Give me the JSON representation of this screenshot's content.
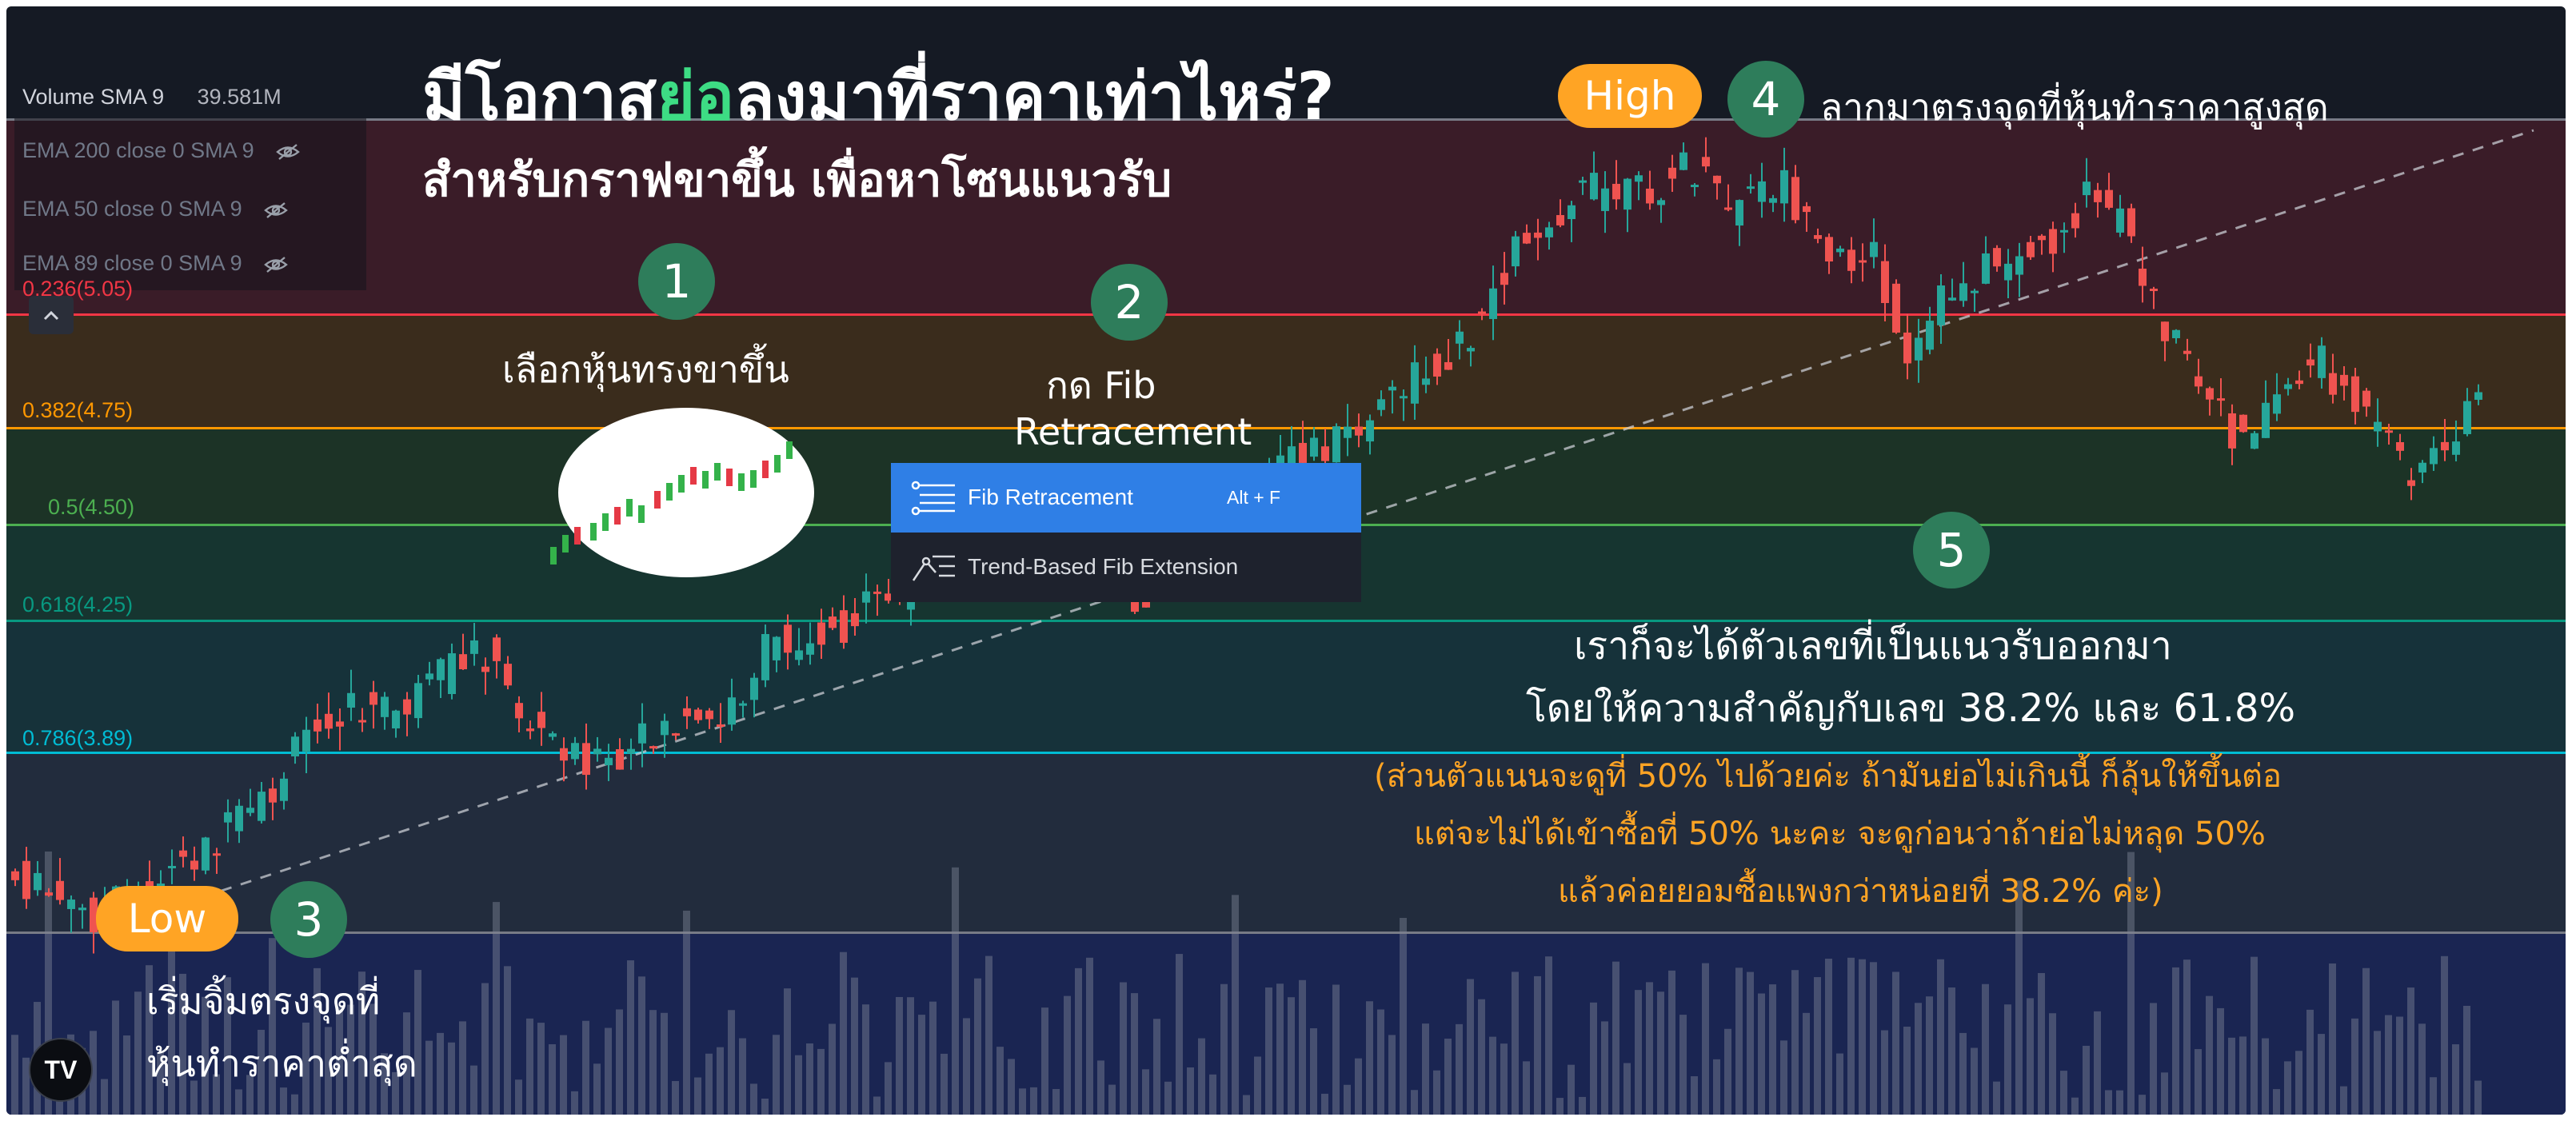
{
  "title": {
    "line1_part1": "มีโอกาส",
    "line1_highlight": "ย่อ",
    "line1_part2": "ลงมาที่ราคาเท่าไหร่?",
    "line2": "สำหรับกราฟขาขึ้น เพื่อหาโซนแนวรับ"
  },
  "colors": {
    "accent_orange": "#ffa424",
    "step_green": "#2e7d5b",
    "highlight_green": "#3ddc84",
    "menu_blue": "#2f7fe6"
  },
  "indicators": [
    {
      "label": "Volume SMA 9",
      "value": "39.581M"
    },
    {
      "label": "EMA 200 close 0 SMA 9",
      "icon": "eye-off-icon"
    },
    {
      "label": "EMA 50 close 0 SMA 9",
      "icon": "eye-off-icon"
    },
    {
      "label": "EMA 89 close 0 SMA 9",
      "icon": "eye-off-icon"
    }
  ],
  "fib_levels": [
    {
      "label": "0.236(5.05)",
      "color": "#f23645"
    },
    {
      "label": "0.382(4.75)",
      "color": "#ff9800"
    },
    {
      "label": "0.5(4.50)",
      "color": "#4caf50"
    },
    {
      "label": "0.618(4.25)",
      "color": "#089981"
    },
    {
      "label": "0.786(3.89)",
      "color": "#00bcd4"
    }
  ],
  "steps": [
    {
      "number": "1",
      "text": "เลือกหุ้นทรงขาขึ้น"
    },
    {
      "number": "2",
      "text_line1": "กด Fib",
      "text_line2": "Retracement"
    },
    {
      "number": "3",
      "badge": "Low",
      "text_line1": "เริ่มจิ้มตรงจุดที่",
      "text_line2": "หุ้นทำราคาต่ำสุด"
    },
    {
      "number": "4",
      "badge": "High",
      "text": "ลากมาตรงจุดที่หุ้นทำราคาสูงสุด"
    },
    {
      "number": "5",
      "text_line1": "เราก็จะได้ตัวเลขที่เป็นแนวรับออกมา",
      "text_line2": "โดยให้ความสำคัญกับเลข 38.2% และ 61.8%"
    }
  ],
  "note": {
    "line1": "(ส่วนตัวแนนจะดูที่ 50% ไปด้วยค่ะ ถ้ามันย่อไม่เกินนี้ ก็ลุ้นให้ขึ้นต่อ",
    "line2": "แต่จะไม่ได้เข้าซื้อที่ 50% นะคะ จะดูก่อนว่าถ้าย่อไม่หลุด 50%",
    "line3": "แล้วค่อยยอมซื้อแพงกว่าหน่อยที่ 38.2% ค่ะ)"
  },
  "menu": {
    "items": [
      {
        "label": "Fib Retracement",
        "shortcut": "Alt + F",
        "icon": "fib-retracement-icon"
      },
      {
        "label": "Trend-Based Fib Extension",
        "icon": "fib-extension-icon"
      }
    ]
  },
  "logo_text": "TV"
}
